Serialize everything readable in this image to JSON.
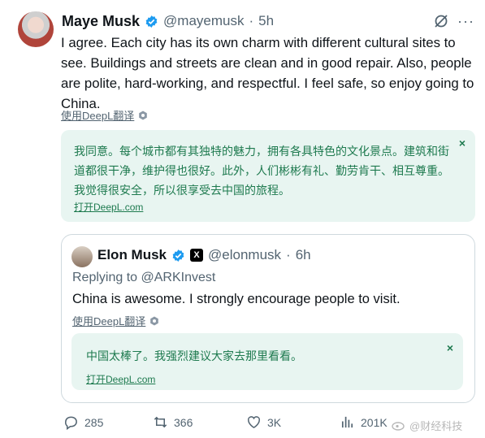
{
  "tweet": {
    "author": {
      "name": "Maye Musk",
      "handle": "@mayemusk",
      "time": "5h",
      "dot": "·"
    },
    "text": "I agree. Each city has its own charm with different cultural sites to see. Buildings and streets are clean and in good repair. Also, people are polite, hard-working, and respectful. I feel safe, so enjoy going to China.",
    "translate_label": "使用DeepL翻译",
    "translation": {
      "text": "我同意。每个城市都有其独特的魅力，拥有各具特色的文化景点。建筑和街道都很干净，维护得也很好。此外，人们彬彬有礼、勤劳肯干、相互尊重。我觉得很安全，所以很享受去中国的旅程。",
      "open_link": "打开DeepL.com",
      "close": "×"
    }
  },
  "quote": {
    "author": {
      "name": "Elon Musk",
      "handle": "@elonmusk",
      "time": "6h",
      "dot": "·",
      "badge": "X"
    },
    "replying_to": "Replying to @ARKInvest",
    "text": "China is awesome. I strongly encourage people to visit.",
    "translate_label": "使用DeepL翻译",
    "translation": {
      "text": "中国太棒了。我强烈建议大家去那里看看。",
      "open_link": "打开DeepL.com",
      "close": "×"
    }
  },
  "actions": {
    "replies": "285",
    "retweets": "366",
    "likes": "3K",
    "views": "201K"
  },
  "watermark": {
    "text": "@财经科技"
  },
  "colors": {
    "verified": "#1d9bf0",
    "translation_bg": "#e8f5f1",
    "translation_text": "#1e7a4f",
    "muted": "#536471"
  }
}
